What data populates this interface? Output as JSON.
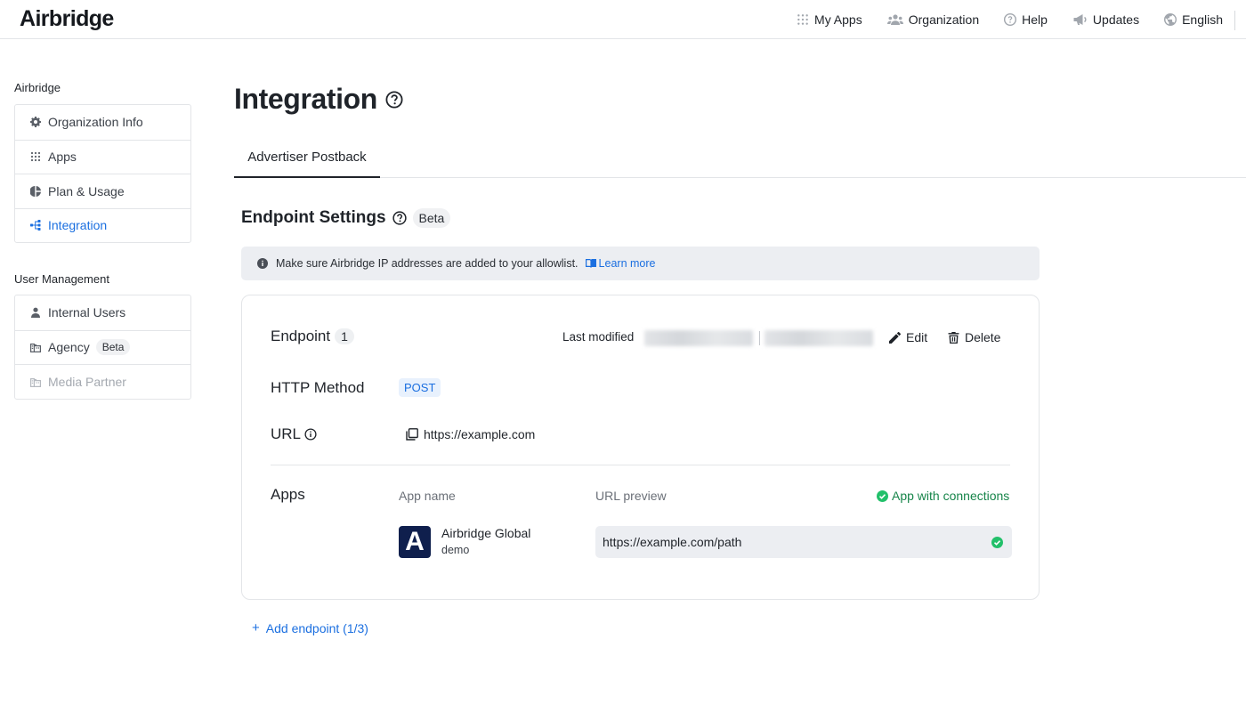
{
  "app": {
    "logo": "Airbridge"
  },
  "topnav": [
    {
      "label": "My Apps",
      "icon": "grid-icon"
    },
    {
      "label": "Organization",
      "icon": "people-icon"
    },
    {
      "label": "Help",
      "icon": "help-circle-icon"
    },
    {
      "label": "Updates",
      "icon": "megaphone-icon"
    },
    {
      "label": "English",
      "icon": "globe-icon"
    }
  ],
  "sidebar": {
    "group1_title": "Airbridge",
    "group1": [
      {
        "label": "Organization Info",
        "icon": "gear-icon"
      },
      {
        "label": "Apps",
        "icon": "grid-icon"
      },
      {
        "label": "Plan & Usage",
        "icon": "pie-chart-icon"
      },
      {
        "label": "Integration",
        "icon": "integration-icon",
        "active": true
      }
    ],
    "group2_title": "User Management",
    "group2": [
      {
        "label": "Internal Users",
        "icon": "user-icon"
      },
      {
        "label": "Agency",
        "icon": "building-icon",
        "badge": "Beta"
      },
      {
        "label": "Media Partner",
        "icon": "building-icon",
        "disabled": true
      }
    ]
  },
  "main": {
    "title": "Integration",
    "tab": "Advertiser Postback",
    "section": {
      "title": "Endpoint Settings",
      "badge": "Beta"
    },
    "notice": {
      "text": "Make sure Airbridge IP addresses are added to your allowlist.",
      "link": "Learn more"
    },
    "endpoint": {
      "label": "Endpoint",
      "number": "1",
      "last_modified_label": "Last modified",
      "edit_label": "Edit",
      "delete_label": "Delete",
      "http_method_label": "HTTP Method",
      "http_method": "POST",
      "url_label": "URL",
      "url": "https://example.com",
      "apps_label": "Apps",
      "col_app_name": "App name",
      "col_url_preview": "URL preview",
      "connections_label": "App with connections",
      "app": {
        "name": "Airbridge Global",
        "sub": "demo",
        "icon_letter": "A"
      },
      "url_preview": "https://example.com/path"
    },
    "add_endpoint": "Add endpoint (1/3)"
  },
  "colors": {
    "accent": "#1b6fe0",
    "success": "#22c06a",
    "app_icon_bg": "#0f1f4d"
  }
}
